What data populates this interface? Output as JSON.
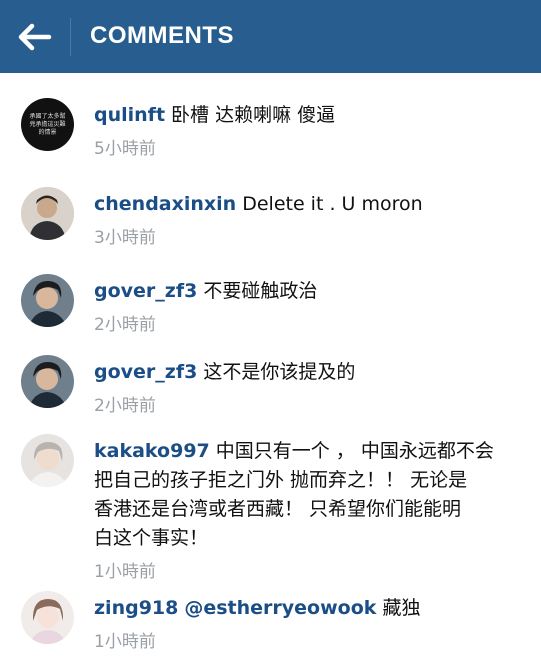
{
  "header": {
    "title": "COMMENTS",
    "back_icon": "back-arrow-icon",
    "background": "#275e8f"
  },
  "comments": [
    {
      "username": "qulinft",
      "text": "卧槽 达赖喇嘛 傻逼",
      "time": "5小時前",
      "avatar_text": "承國了太多幫兇承擔這災難的情景"
    },
    {
      "username": "chendaxinxin",
      "text": "Delete it . U moron",
      "time": "3小時前"
    },
    {
      "username": "gover_zf3",
      "text": "不要碰触政治",
      "time": "2小時前"
    },
    {
      "username": "gover_zf3",
      "text": "这不是你该提及的",
      "time": "2小時前"
    },
    {
      "username": "kakako997",
      "lines": [
        "中国只有一个 ， 中国永远都不会",
        "把自己的孩子拒之门外 抛而弃之！！ 无论是",
        "香港还是台湾或者西藏！ 只希望你们能能明",
        "白这个事实！"
      ],
      "time": "1小時前"
    },
    {
      "username": "zing918",
      "mention": "@estherryeowook",
      "text": "藏独",
      "time": "1小時前"
    }
  ],
  "colors": {
    "username": "#1b4e86",
    "time": "#9aa0a6",
    "text": "#111111"
  }
}
